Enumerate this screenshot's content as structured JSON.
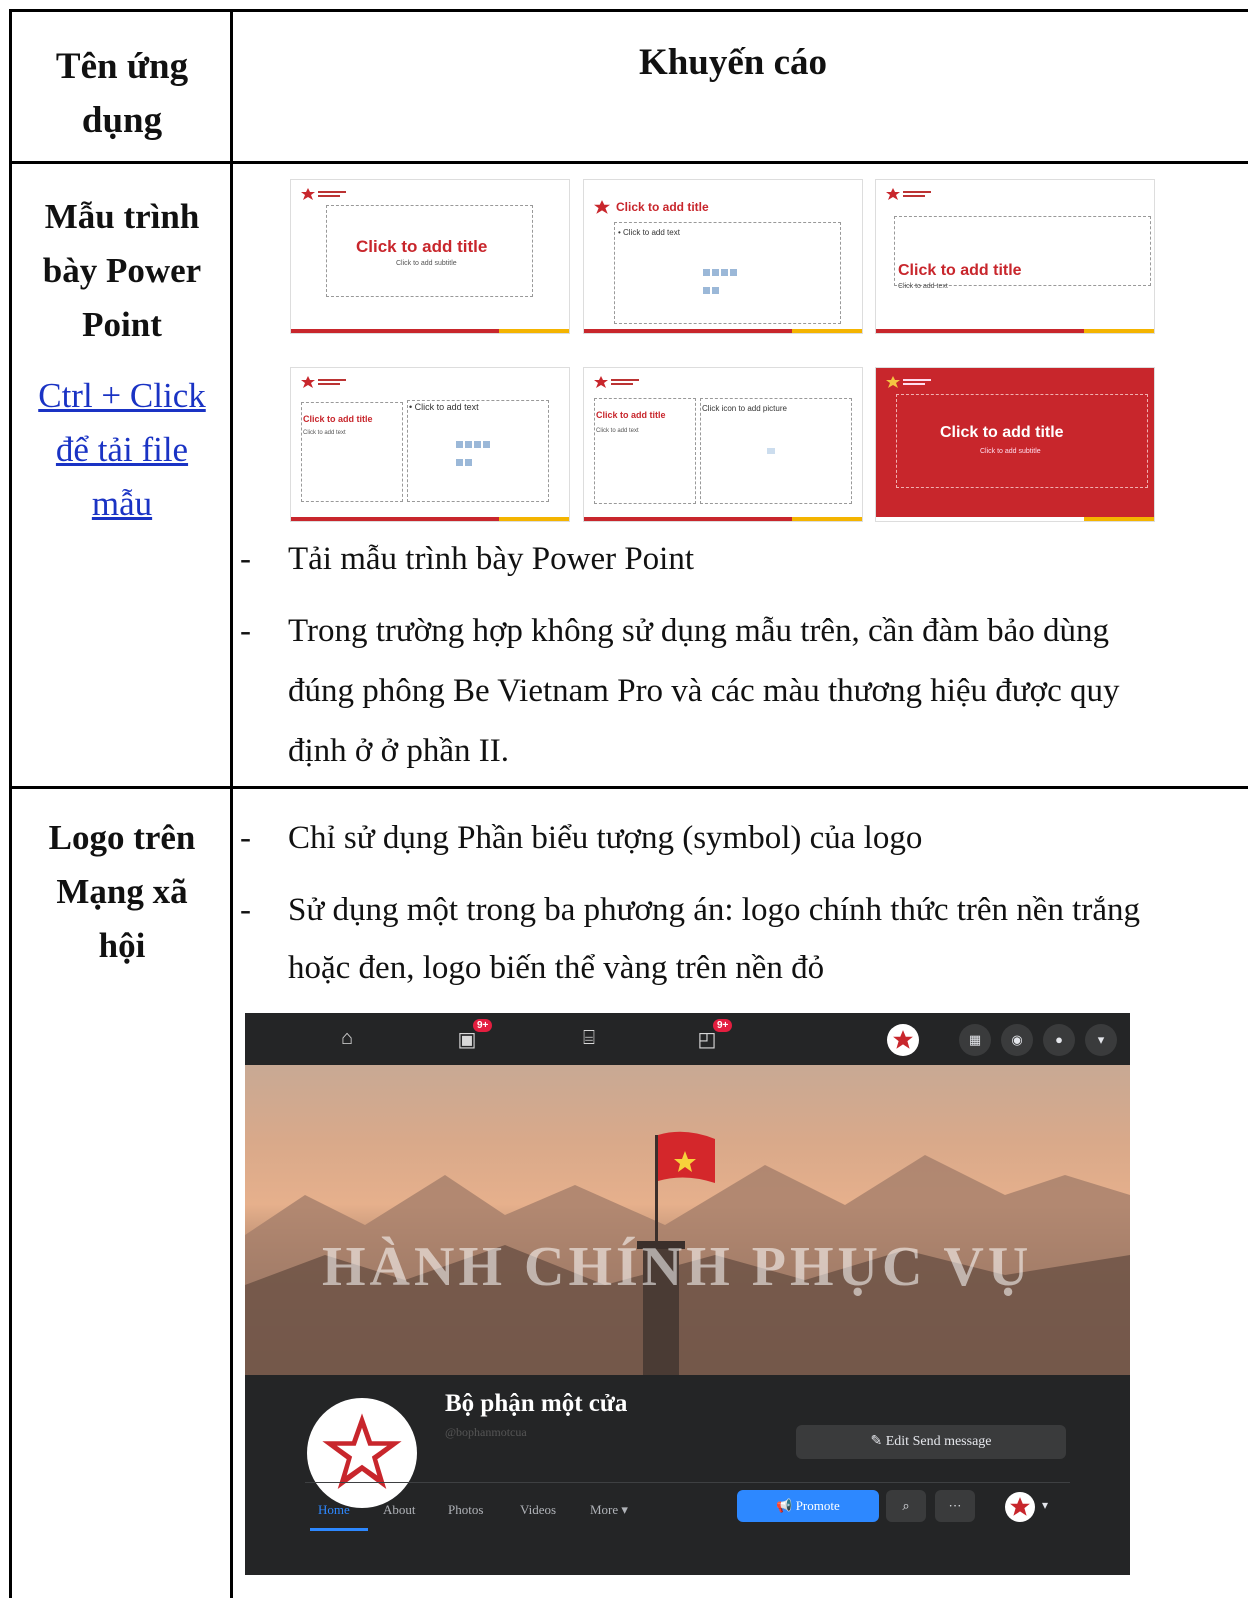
{
  "table": {
    "header_col1": "Tên ứng dụng",
    "header_col2": "Khuyến cáo"
  },
  "row1": {
    "name_line1": "Mẫu trình",
    "name_line2": "bày Power",
    "name_line3": "Point",
    "link_line1": "Ctrl + Click",
    "link_line2": "để tải file",
    "link_line3": "mẫu",
    "bullets": [
      {
        "dash": "-",
        "text": "Tải mẫu trình bày Power Point"
      },
      {
        "dash": "-",
        "line1": "Trong trường hợp không sử dụng mẫu trên, cần đàm bảo dùng",
        "line2": "đúng phông Be Vietnam Pro và các màu thương hiệu được quy",
        "line3": "định ở ở phần II."
      }
    ],
    "slides": {
      "title": "Click to add title",
      "subtitle": "Click to add subtitle",
      "add_text": "• Click to add text",
      "add_text_small": "Click to add text",
      "add_picture": "Click icon to add picture"
    }
  },
  "row2": {
    "name_line1": "Logo trên",
    "name_line2": "Mạng xã",
    "name_line3": "hội",
    "bullets": [
      {
        "dash": "-",
        "text": "Chỉ sử dụng Phần biểu tượng  (symbol) của logo"
      },
      {
        "dash": "-",
        "line1": "Sử dụng một trong ba phương án: logo chính thức trên nền trắng",
        "line2": "hoặc đen, logo biến thể vàng trên nền đỏ"
      }
    ],
    "facebook": {
      "badge_video": "9+",
      "badge_gaming": "9+",
      "cover_text": "HÀNH CHÍNH PHỤC VỤ",
      "page_name": "Bộ phận một cửa",
      "handle": "@bophanmotcua",
      "edit_button": "Edit Send message",
      "tabs": [
        "Home",
        "About",
        "Photos",
        "Videos",
        "More ▾"
      ],
      "promote_button": "Promote",
      "search_icon_glyph": "⌕",
      "more_glyph": "···",
      "brand_red": "#c8262c",
      "accent_blue": "#2d88ff"
    }
  }
}
